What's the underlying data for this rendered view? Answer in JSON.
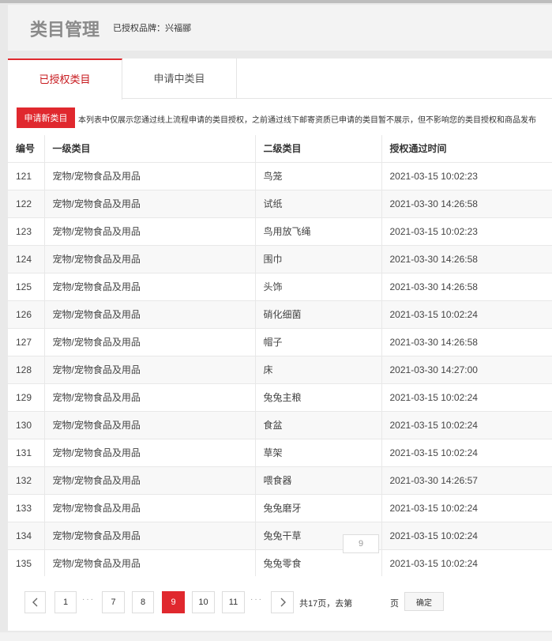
{
  "header": {
    "title": "类目管理",
    "brand_label": "已授权品牌：兴福郦"
  },
  "tabs": [
    {
      "label": "已授权类目",
      "active": true
    },
    {
      "label": "申请中类目",
      "active": false
    }
  ],
  "toolbar": {
    "apply_label": "申请新类目",
    "notice": "本列表中仅展示您通过线上流程申请的类目授权，之前通过线下邮寄资质已申请的类目暂不展示，但不影响您的类目授权和商品发布"
  },
  "table": {
    "columns": [
      "编号",
      "一级类目",
      "二级类目",
      "授权通过时间"
    ],
    "rows": [
      [
        "121",
        "宠物/宠物食品及用品",
        "鸟笼",
        "2021-03-15 10:02:23"
      ],
      [
        "122",
        "宠物/宠物食品及用品",
        "试纸",
        "2021-03-30 14:26:58"
      ],
      [
        "123",
        "宠物/宠物食品及用品",
        "鸟用放飞绳",
        "2021-03-15 10:02:23"
      ],
      [
        "124",
        "宠物/宠物食品及用品",
        "围巾",
        "2021-03-30 14:26:58"
      ],
      [
        "125",
        "宠物/宠物食品及用品",
        "头饰",
        "2021-03-30 14:26:58"
      ],
      [
        "126",
        "宠物/宠物食品及用品",
        "硝化细菌",
        "2021-03-15 10:02:24"
      ],
      [
        "127",
        "宠物/宠物食品及用品",
        "帽子",
        "2021-03-30 14:26:58"
      ],
      [
        "128",
        "宠物/宠物食品及用品",
        "床",
        "2021-03-30 14:27:00"
      ],
      [
        "129",
        "宠物/宠物食品及用品",
        "兔兔主粮",
        "2021-03-15 10:02:24"
      ],
      [
        "130",
        "宠物/宠物食品及用品",
        "食盆",
        "2021-03-15 10:02:24"
      ],
      [
        "131",
        "宠物/宠物食品及用品",
        "草架",
        "2021-03-15 10:02:24"
      ],
      [
        "132",
        "宠物/宠物食品及用品",
        "喂食器",
        "2021-03-30 14:26:57"
      ],
      [
        "133",
        "宠物/宠物食品及用品",
        "兔兔磨牙",
        "2021-03-15 10:02:24"
      ],
      [
        "134",
        "宠物/宠物食品及用品",
        "兔兔干草",
        "2021-03-15 10:02:24"
      ],
      [
        "135",
        "宠物/宠物食品及用品",
        "兔兔零食",
        "2021-03-15 10:02:24"
      ]
    ]
  },
  "pagination": {
    "pages": [
      "1",
      "7",
      "8",
      "9",
      "10",
      "11"
    ],
    "current": "9",
    "ellipsis": "···",
    "total_text": "共17页，去第",
    "page_suffix": "页",
    "goto_value": "9",
    "confirm_label": "确定"
  },
  "colors": {
    "accent": "#e0282e",
    "active_tab_text": "#c7191e"
  }
}
